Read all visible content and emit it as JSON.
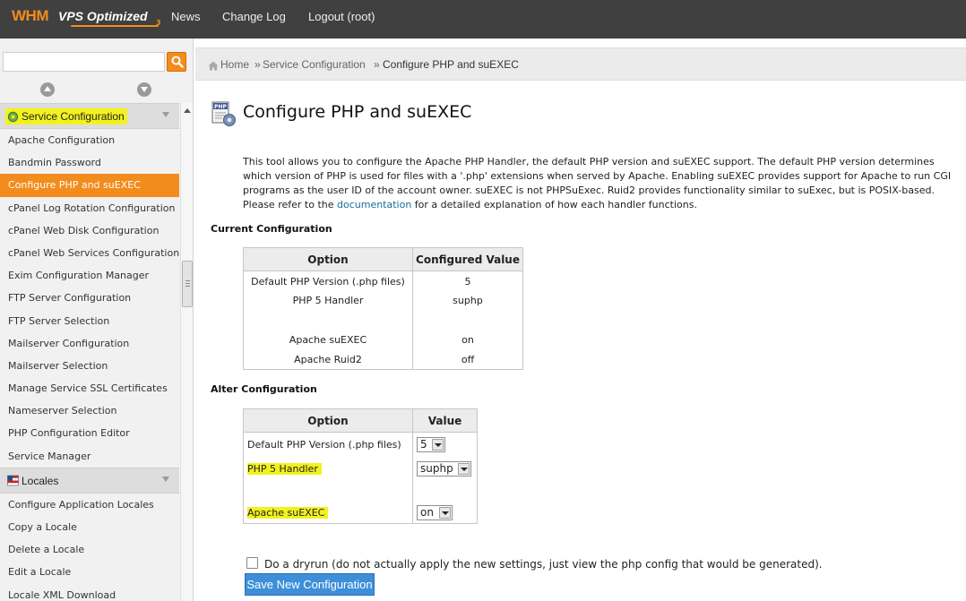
{
  "header": {
    "logo_whm": "WHM",
    "logo_vps": "VPS Optimized",
    "logo_sub": "3",
    "nav": [
      "News",
      "Change Log",
      "Logout (root)"
    ]
  },
  "sidebar": {
    "search_placeholder": "",
    "groups": [
      {
        "title": "Service Configuration",
        "items": [
          "Apache Configuration",
          "Bandmin Password",
          "Configure PHP and suEXEC",
          "cPanel Log Rotation Configuration",
          "cPanel Web Disk Configuration",
          "cPanel Web Services Configuration",
          "Exim Configuration Manager",
          "FTP Server Configuration",
          "FTP Server Selection",
          "Mailserver Configuration",
          "Mailserver Selection",
          "Manage Service SSL Certificates",
          "Nameserver Selection",
          "PHP Configuration Editor",
          "Service Manager"
        ]
      },
      {
        "title": "Locales",
        "items": [
          "Configure Application Locales",
          "Copy a Locale",
          "Delete a Locale",
          "Edit a Locale",
          "Locale XML Download"
        ]
      }
    ]
  },
  "breadcrumb": {
    "home": "Home",
    "sep": "»",
    "section": "Service Configuration",
    "current": "Configure PHP and suEXEC"
  },
  "main": {
    "page_icon_label": "PHP",
    "title": "Configure PHP and suEXEC",
    "description_pre": "This tool allows you to configure the Apache PHP Handler, the default PHP version and suEXEC support. The default PHP version determines which version of PHP is used for files with a '.php' extensions when served by Apache. Enabling suEXEC provides support for Apache to run CGI programs as the user ID of the account owner. suEXEC is not PHPSuExec. Ruid2 provides functionality similar to suExec, but is POSIX-based. Please refer to the ",
    "description_link": "documentation",
    "description_post": " for a detailed explanation of how each handler functions.",
    "current_heading": "Current Configuration",
    "current_table": {
      "headers": [
        "Option",
        "Configured Value"
      ],
      "rows": [
        {
          "option": "Default PHP Version (.php files)",
          "value": "5"
        },
        {
          "option": "PHP 5 Handler",
          "value": "suphp"
        },
        {
          "option": "",
          "value": ""
        },
        {
          "option": "Apache suEXEC",
          "value": "on"
        },
        {
          "option": "Apache Ruid2",
          "value": "off"
        }
      ]
    },
    "alter_heading": "Alter Configuration",
    "alter_table": {
      "headers": [
        "Option",
        "Value"
      ],
      "rows": [
        {
          "option": "Default PHP Version (.php files)",
          "value": "5"
        },
        {
          "option": "PHP 5 Handler",
          "value": "suphp"
        },
        {
          "option": "Apache suEXEC",
          "value": "on"
        }
      ]
    },
    "dryrun_label": "Do a dryrun (do not actually apply the new settings, just view the php config that would be generated).",
    "save_button": "Save New Configuration"
  },
  "colors": {
    "topbar": "#404040",
    "accent_orange": "#f28c1c",
    "highlight_yellow": "#f2f21e",
    "button_blue": "#3d8fd9",
    "link_blue": "#1a6e9a"
  }
}
